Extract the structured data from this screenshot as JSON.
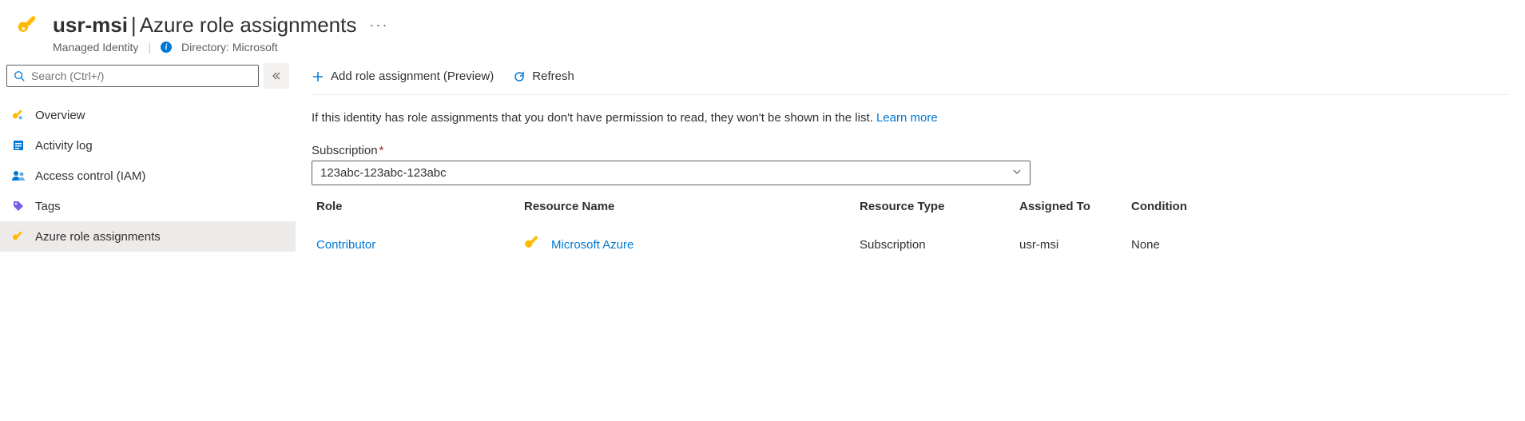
{
  "header": {
    "resource_name": "usr-msi",
    "page_title": "Azure role assignments",
    "resource_type": "Managed Identity",
    "directory_label": "Directory:",
    "directory_value": "Microsoft"
  },
  "sidebar": {
    "search_placeholder": "Search (Ctrl+/)",
    "items": [
      {
        "label": "Overview",
        "icon": "key-icon"
      },
      {
        "label": "Activity log",
        "icon": "log-icon"
      },
      {
        "label": "Access control (IAM)",
        "icon": "people-icon"
      },
      {
        "label": "Tags",
        "icon": "tag-icon"
      },
      {
        "label": "Azure role assignments",
        "icon": "key-icon"
      }
    ]
  },
  "toolbar": {
    "add_label": "Add role assignment (Preview)",
    "refresh_label": "Refresh"
  },
  "main": {
    "info_text": "If this identity has role assignments that you don't have permission to read, they won't be shown in the list.",
    "learn_more": "Learn more",
    "subscription_label": "Subscription",
    "subscription_value": "123abc-123abc-123abc",
    "columns": {
      "role": "Role",
      "resource_name": "Resource Name",
      "resource_type": "Resource Type",
      "assigned_to": "Assigned To",
      "condition": "Condition"
    },
    "rows": [
      {
        "role": "Contributor",
        "resource_name": "Microsoft Azure",
        "resource_type": "Subscription",
        "assigned_to": "usr-msi",
        "condition": "None"
      }
    ]
  }
}
